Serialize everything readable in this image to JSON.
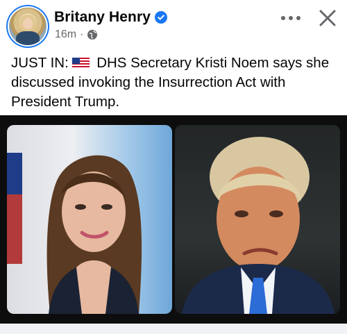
{
  "post": {
    "author_name": "Britany Henry",
    "verified": true,
    "time_ago": "16m",
    "separator": "·",
    "audience_icon": "globe-icon",
    "text_prefix": "JUST IN:",
    "flag_icon": "us-flag-icon",
    "text_body": "DHS Secretary Kristi Noem says she discussed invoking the Insurrection Act with President Trump."
  },
  "actions": {
    "more_icon": "more-options-icon",
    "close_icon": "close-icon"
  },
  "colors": {
    "accent": "#1877f2",
    "text_primary": "#050505",
    "text_secondary": "#65676b",
    "media_background": "#0d0d0d"
  },
  "media": {
    "layout": "two-photo-collage"
  }
}
